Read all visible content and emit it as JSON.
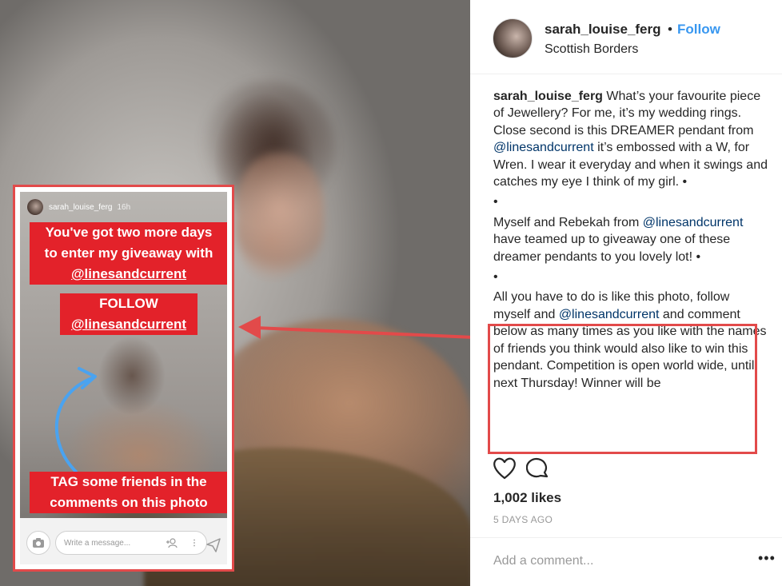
{
  "post": {
    "username": "sarah_louise_ferg",
    "follow_label": "Follow",
    "separator": "•",
    "location": "Scottish Borders",
    "likes": "1,002 likes",
    "time_ago": "5 DAYS AGO",
    "add_comment_placeholder": "Add a comment...",
    "more_label": "•••"
  },
  "caption": {
    "p1_username": "sarah_louise_ferg",
    "p1_a": " What’s your favourite piece of Jewellery? For me, it’s my wedding rings. Close second is this DREAMER pendant from ",
    "p1_mention": "@linesandcurrent",
    "p1_b": " it’s embossed with a W, for Wren. I wear it everyday and when it swings and catches my eye I think of my girl. •",
    "dot1": "•",
    "p2_a": "Myself and Rebekah from ",
    "p2_mention": "@linesandcurrent",
    "p2_b": " have teamed up to giveaway one of these dreamer pendants to you lovely lot! •",
    "dot2": "•",
    "p3_a": "All you have to do is like this photo, follow myself and ",
    "p3_mention": "@linesandcurrent",
    "p3_b": " and comment below as many times as you like with the names of friends you think would also like to win this pendant. Competition is open world wide, until next Thursday! Winner will be"
  },
  "story": {
    "username": "sarah_louise_ferg",
    "time": "16h",
    "tag1_line1": "You've got two more days",
    "tag1_line2": "to enter my giveaway with",
    "tag1_mention": "@linesandcurrent",
    "tag2_line1": "FOLLOW",
    "tag2_mention": "@linesandcurrent",
    "tag3_line1": "TAG some friends in the",
    "tag3_line2": "comments on this photo",
    "message_placeholder": "Write a message..."
  },
  "colors": {
    "highlight": "#e24a4a",
    "story_tag": "#e3222a",
    "follow": "#3897f0",
    "mention": "#003569"
  },
  "icons": [
    "heart-icon",
    "comment-icon",
    "camera-icon",
    "add-person-icon",
    "more-icon",
    "send-icon",
    "arrow-icon"
  ]
}
